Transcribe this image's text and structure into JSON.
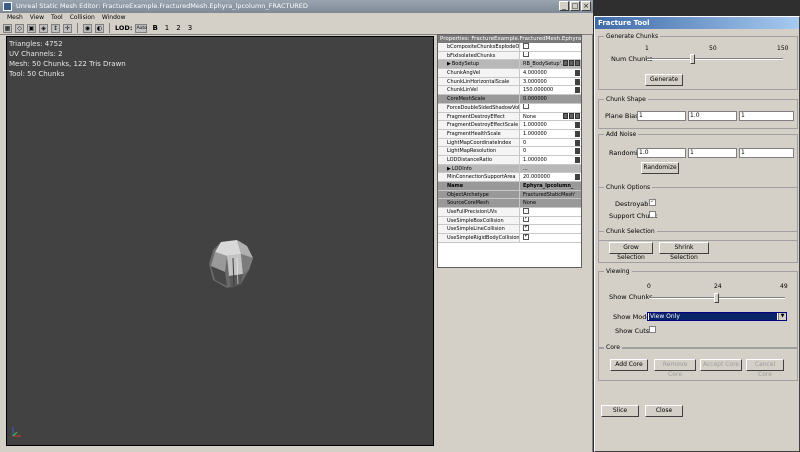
{
  "sme": {
    "title": "Unreal Static Mesh Editor: FractureExample.FracturedMesh.Ephyra_lpcolumn_FRACTURED",
    "menu": [
      "Mesh",
      "View",
      "Tool",
      "Collision",
      "Window"
    ],
    "toolbar": {
      "lod_label": "LOD:",
      "lod_auto": "Auto",
      "lod_b": "B",
      "lod_1": "1",
      "lod_2": "2",
      "lod_3": "3"
    },
    "stats": {
      "triangles": "Triangles:  4752",
      "uv_channels": "UV Channels:  2",
      "mesh": "Mesh: 50 Chunks, 122 Tris Drawn",
      "tool": "Tool: 50 Chunks"
    }
  },
  "props": {
    "title": "Properties: FractureExample.FracturedMesh.Ephyra_lp...",
    "rows": [
      {
        "name": "bCompositeChunksExplodeOnImpact",
        "value": "",
        "check": false
      },
      {
        "name": "bFixIsolatedChunks",
        "value": "",
        "check": false
      },
      {
        "name": "BodySetup",
        "value": "RB_BodySetup'...",
        "cat": true
      },
      {
        "name": "ChunkAngVel",
        "value": "4.000000"
      },
      {
        "name": "ChunkLinHorizontalScale",
        "value": "3.000000"
      },
      {
        "name": "ChunkLinVel",
        "value": "150.000000"
      },
      {
        "name": "CoreMeshScale",
        "value": "0.000000",
        "hl": true
      },
      {
        "name": "ForceDoubleSidedShadowVolume",
        "value": "",
        "check": false
      },
      {
        "name": "FragmentDestroyEffect",
        "value": "None"
      },
      {
        "name": "FragmentDestroyEffectScale",
        "value": "1.000000"
      },
      {
        "name": "FragmentHealthScale",
        "value": "1.000000"
      },
      {
        "name": "LightMapCoordinateIndex",
        "value": "0"
      },
      {
        "name": "LightMapResolution",
        "value": "0"
      },
      {
        "name": "LODDistanceRatio",
        "value": "1.000000"
      },
      {
        "name": "LODInfo",
        "value": "...",
        "cat": true
      },
      {
        "name": "MinConnectionSupportArea",
        "value": "20.000000"
      },
      {
        "name": "Name",
        "value": "Ephyra_lpcolumn_",
        "hl": true,
        "bold": true
      },
      {
        "name": "ObjectArchetype",
        "value": "FracturedStaticMesh'",
        "hl": true
      },
      {
        "name": "SourceCoreMesh",
        "value": "None",
        "hl": true
      },
      {
        "name": "UseFullPrecisionUVs",
        "value": "",
        "check": false
      },
      {
        "name": "UseSimpleBoxCollision",
        "value": "",
        "check": true
      },
      {
        "name": "UseSimpleLineCollision",
        "value": "",
        "check": true
      },
      {
        "name": "UseSimpleRigidBodyCollision",
        "value": "",
        "check": true
      }
    ]
  },
  "ft": {
    "title": "Fracture Tool",
    "generate": {
      "title": "Generate Chunks",
      "num_label": "Num Chunks",
      "min": "1",
      "mid": "50",
      "max": "150",
      "value_fraction": 0.33,
      "button": "Generate"
    },
    "shape": {
      "title": "Chunk Shape",
      "label": "Plane Bias",
      "x": "1",
      "y": "1.0",
      "z": "1"
    },
    "noise": {
      "title": "Add Noise",
      "label": "Randomize",
      "x": "1.0",
      "y": "1",
      "z": "1",
      "button": "Randomize"
    },
    "options": {
      "title": "Chunk Options",
      "destroyable": "Destroyable",
      "support": "Support Chunk",
      "destroyable_checked": true,
      "support_checked": false
    },
    "selection": {
      "title": "Chunk Selection",
      "grow": "Grow Selection",
      "shrink": "Shrink Selection"
    },
    "viewing": {
      "title": "Viewing",
      "show_chunks": "Show Chunks",
      "min": "0",
      "mid": "24",
      "max": "49",
      "value_fraction": 0.49,
      "show_mode": "Show Mode",
      "mode_value": "View Only",
      "show_cuts": "Show Cuts",
      "cuts_checked": false
    },
    "core": {
      "title": "Core",
      "add": "Add Core",
      "remove": "Remove Core",
      "accept": "Accept Core",
      "cancel": "Cancel Core"
    },
    "slice": "Slice",
    "close": "Close"
  }
}
